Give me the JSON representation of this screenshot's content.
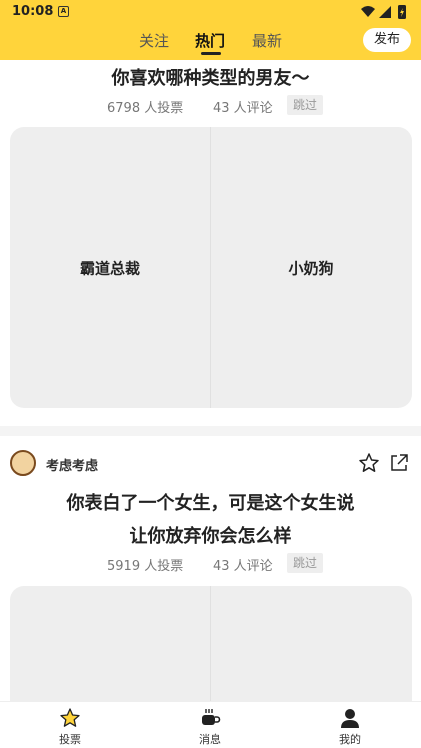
{
  "status_bar": {
    "time": "10:08",
    "notification_icon": "A"
  },
  "header": {
    "tabs": [
      {
        "label": "关注",
        "active": false
      },
      {
        "label": "热门",
        "active": true
      },
      {
        "label": "最新",
        "active": false
      }
    ],
    "publish_label": "发布"
  },
  "feed": [
    {
      "question": "你喜欢哪种类型的男友～",
      "votes": "6798 人投票",
      "comments": "43 人评论",
      "skip_label": "跳过",
      "options": [
        "霸道总裁",
        "小奶狗"
      ]
    },
    {
      "author": "考虑考虑",
      "question_line1": "你表白了一个女生，可是这个女生说",
      "question_line2": "让你放弃你会怎么样",
      "votes": "5919 人投票",
      "comments": "43 人评论",
      "skip_label": "跳过"
    }
  ],
  "bottom_nav": [
    {
      "label": "投票",
      "icon": "star-icon"
    },
    {
      "label": "消息",
      "icon": "cup-icon"
    },
    {
      "label": "我的",
      "icon": "person-icon"
    }
  ],
  "colors": {
    "accent": "#ffd43b"
  }
}
